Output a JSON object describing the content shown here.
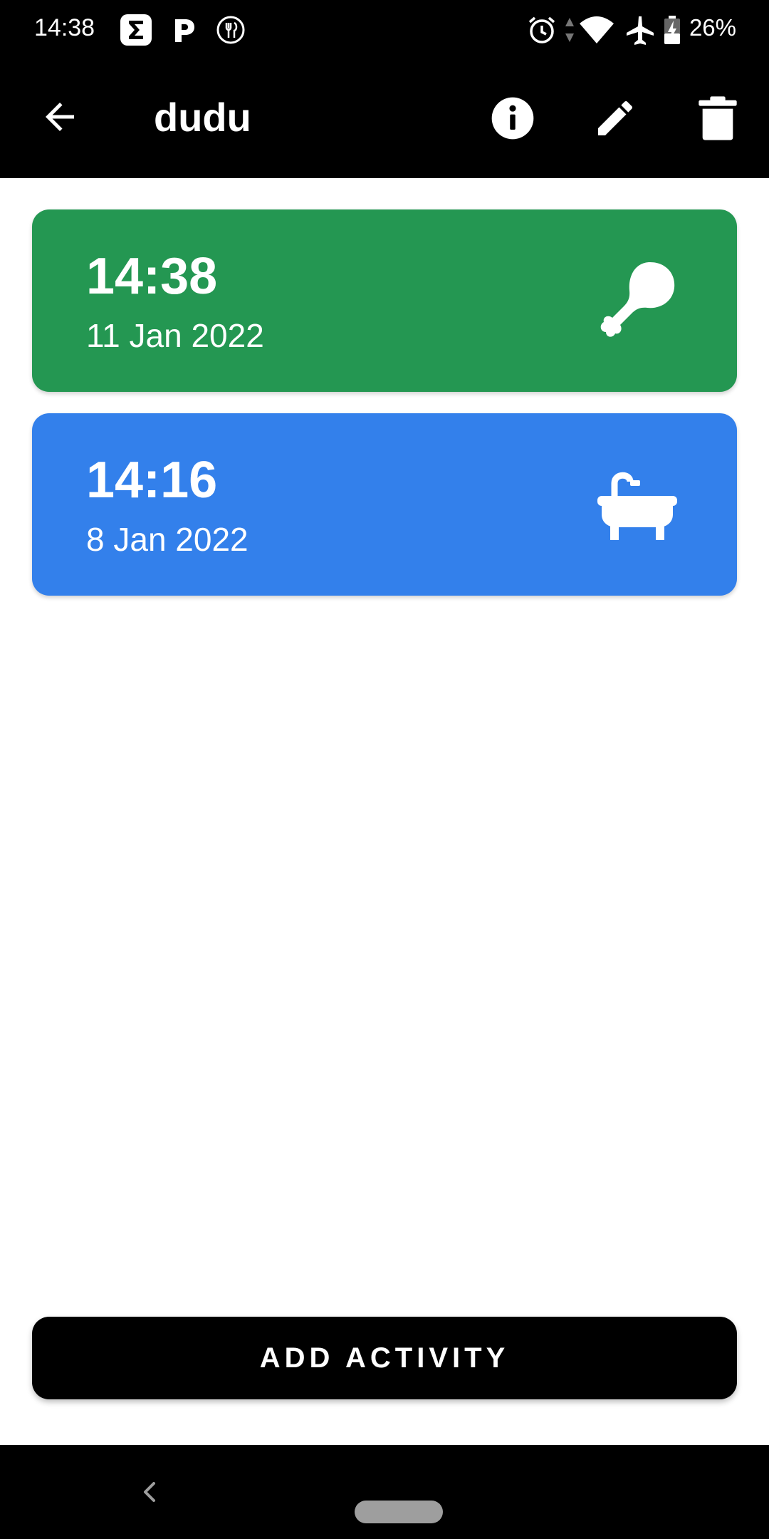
{
  "status_bar": {
    "time": "14:38",
    "notification_icons": [
      "sigma-app-icon",
      "p-app-icon",
      "food-app-icon"
    ],
    "system_icons": [
      "alarm-icon",
      "data-arrows-icon",
      "wifi-icon",
      "airplane-icon",
      "battery-charging-icon"
    ],
    "battery_percent": "26%"
  },
  "app_bar": {
    "title": "dudu",
    "back_icon": "arrow-back-icon",
    "actions": [
      "info-icon",
      "edit-icon",
      "delete-icon"
    ]
  },
  "activities": [
    {
      "time": "14:38",
      "date": "11 Jan 2022",
      "icon": "drumstick-icon",
      "color": "#249752"
    },
    {
      "time": "14:16",
      "date": "8 Jan 2022",
      "icon": "bathtub-icon",
      "color": "#3380EB"
    }
  ],
  "add_button": {
    "label": "ADD ACTIVITY"
  },
  "colors": {
    "bar_background": "#000000",
    "page_background": "#FFFFFF",
    "feed_card": "#249752",
    "bath_card": "#3380EB"
  }
}
